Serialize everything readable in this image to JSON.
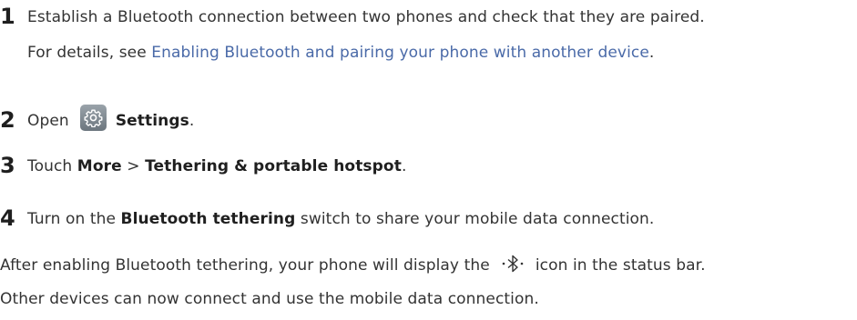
{
  "steps": [
    {
      "number": "1",
      "line1": "Establish a Bluetooth connection between two phones and check that they are paired.",
      "line2_prefix": "For details, see ",
      "line2_link": "Enabling Bluetooth and pairing your phone with another device",
      "line2_suffix": "."
    },
    {
      "number": "2",
      "prefix": "Open",
      "icon": "settings-gear-icon",
      "bold": "Settings",
      "suffix": "."
    },
    {
      "number": "3",
      "prefix": "Touch ",
      "bold1": "More",
      "separator": " > ",
      "bold2": "Tethering & portable hotspot",
      "suffix": "."
    },
    {
      "number": "4",
      "prefix": "Turn on the ",
      "bold": "Bluetooth tethering",
      "suffix": " switch to share your mobile data connection."
    }
  ],
  "note": {
    "line1_prefix": "After enabling Bluetooth tethering, your phone will display the",
    "icon": "bluetooth-tethering-icon",
    "line1_suffix": "icon in the status bar.",
    "line2": "Other devices can now connect and use the mobile data connection."
  },
  "colors": {
    "text": "#333333",
    "link": "#4a6aa8",
    "icon_bg": "#7d868d"
  }
}
